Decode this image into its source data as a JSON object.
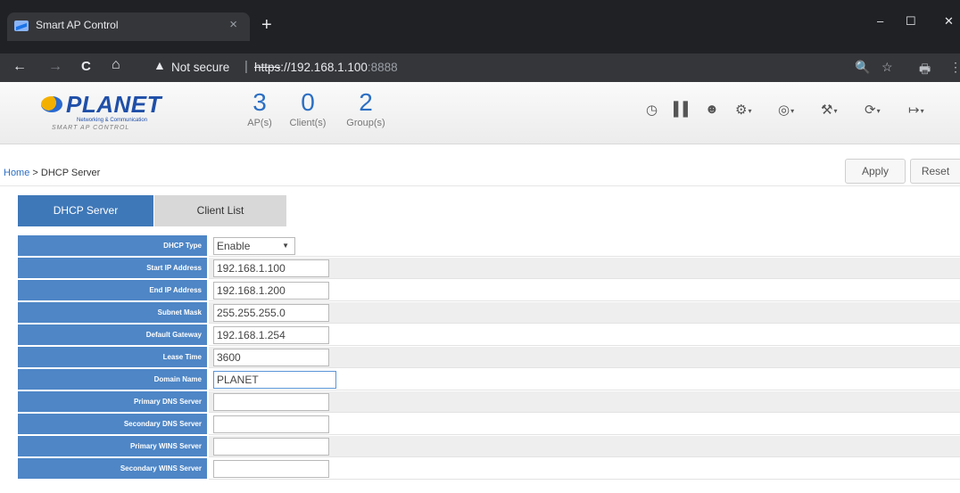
{
  "browser": {
    "tab_title": "Smart AP Control",
    "tab_close": "×",
    "new_tab": "+",
    "win_min": "–",
    "win_max": "☐",
    "win_close": "✕",
    "nav_back": "←",
    "nav_forward": "→",
    "nav_reload": "C",
    "nav_home": "⌂",
    "security_icon": "▲",
    "security_text": "Not secure",
    "separator": "|",
    "url_scheme": "https",
    "url_host": "://192.168.1.100",
    "url_port": ":8888",
    "zoom_icon": "🔍",
    "star_icon": "☆",
    "printer_icon": "🖶",
    "menu_icon": "⋮"
  },
  "header": {
    "logo_name": "PLANET",
    "logo_tagline": "Networking & Communication",
    "logo_subtitle": "SMART AP CONTROL",
    "stats": [
      {
        "value": "3",
        "label": "AP(s)"
      },
      {
        "value": "0",
        "label": "Client(s)"
      },
      {
        "value": "2",
        "label": "Group(s)"
      }
    ],
    "icons": [
      "dashboard-icon",
      "stats-icon",
      "users-icon",
      "settings-icon",
      "globe-icon",
      "tools-icon",
      "refresh-icon",
      "logout-icon"
    ]
  },
  "breadcrumb": {
    "home": "Home",
    "arrow": " > ",
    "current": "DHCP Server"
  },
  "actions": {
    "apply": "Apply",
    "reset": "Reset"
  },
  "tabs": {
    "dhcp_server": "DHCP Server",
    "client_list": "Client List"
  },
  "form": {
    "rows": [
      {
        "label": "DHCP Type",
        "value": "Enable",
        "kind": "select"
      },
      {
        "label": "Start IP Address",
        "value": "192.168.1.100",
        "kind": "input"
      },
      {
        "label": "End IP Address",
        "value": "192.168.1.200",
        "kind": "input"
      },
      {
        "label": "Subnet Mask",
        "value": "255.255.255.0",
        "kind": "input"
      },
      {
        "label": "Default Gateway",
        "value": "192.168.1.254",
        "kind": "input"
      },
      {
        "label": "Lease Time",
        "value": "3600",
        "kind": "input"
      },
      {
        "label": "Domain Name",
        "value": "PLANET",
        "kind": "input"
      },
      {
        "label": "Primary DNS Server",
        "value": "",
        "kind": "input"
      },
      {
        "label": "Secondary DNS Server",
        "value": "",
        "kind": "input"
      },
      {
        "label": "Primary WINS Server",
        "value": "",
        "kind": "input"
      },
      {
        "label": "Secondary WINS Server",
        "value": "",
        "kind": "input"
      }
    ]
  }
}
